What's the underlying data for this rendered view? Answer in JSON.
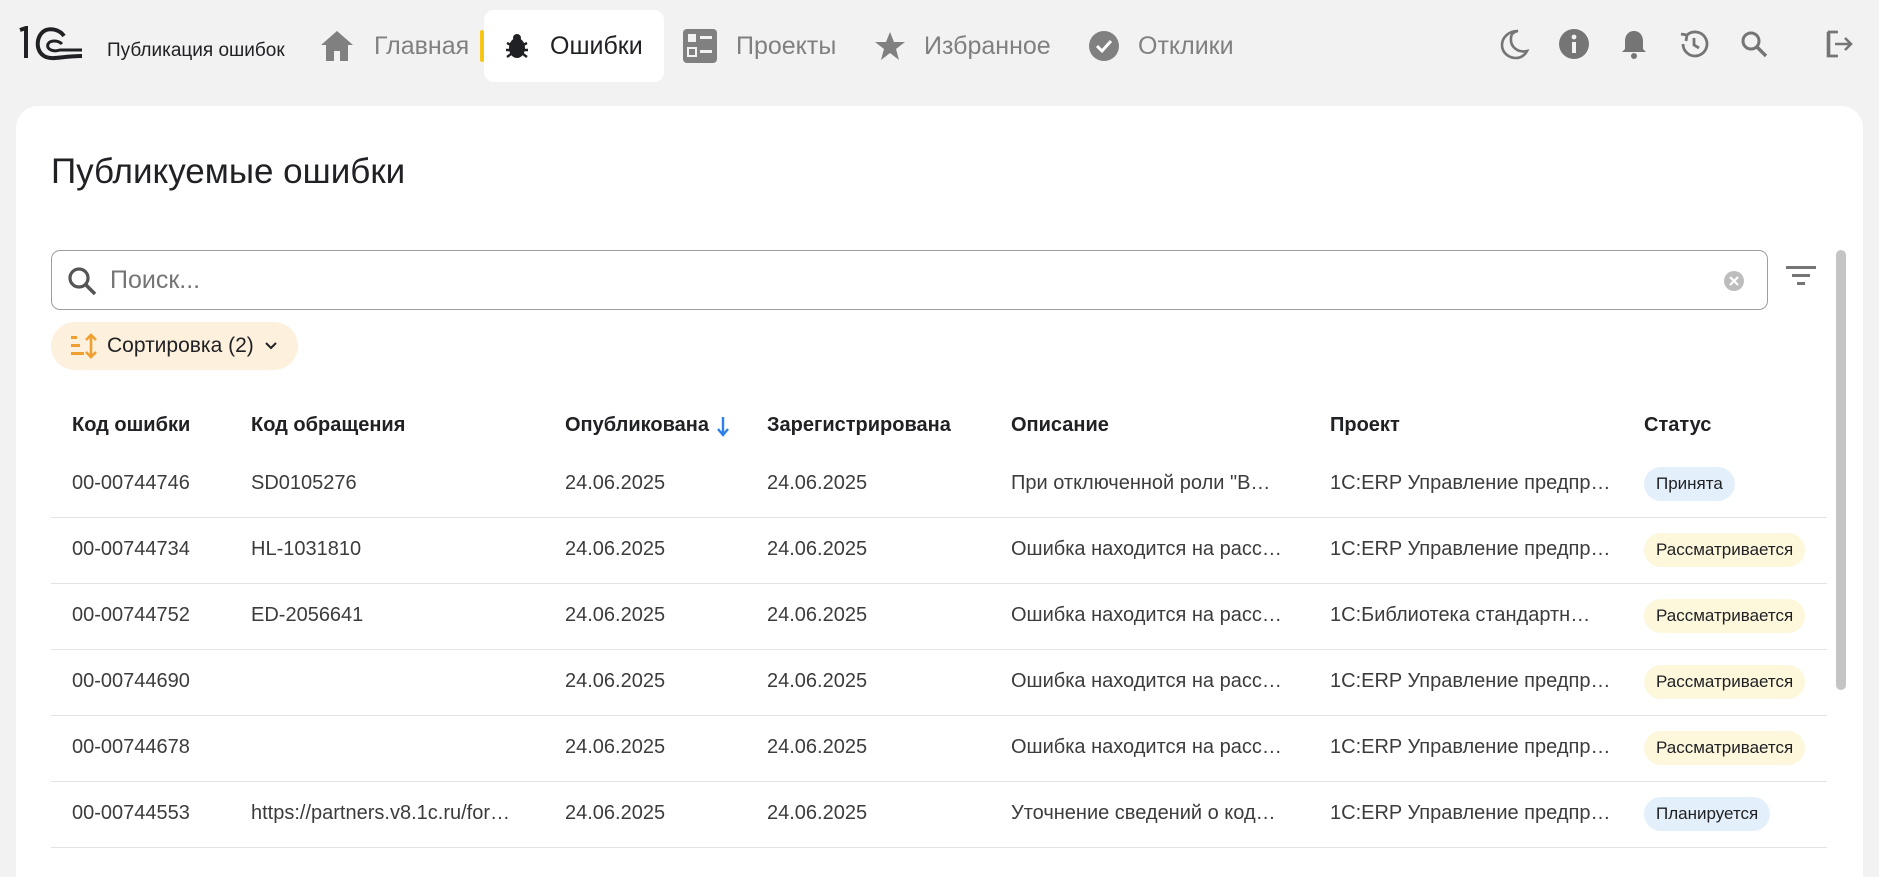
{
  "app": {
    "title": "Публикация ошибок",
    "logo": "1С"
  },
  "nav": {
    "items": [
      {
        "label": "Главная",
        "icon": "home-icon"
      },
      {
        "label": "Ошибки",
        "icon": "bug-icon",
        "active": true
      },
      {
        "label": "Проекты",
        "icon": "projects-icon"
      },
      {
        "label": "Избранное",
        "icon": "star-icon"
      },
      {
        "label": "Отклики",
        "icon": "check-circle-icon"
      }
    ],
    "right_icons": [
      "moon-icon",
      "info-icon",
      "bell-icon",
      "history-icon",
      "search-icon",
      "logout-icon"
    ]
  },
  "page": {
    "title": "Публикуемые ошибки"
  },
  "search": {
    "placeholder": "Поиск...",
    "value": ""
  },
  "sort": {
    "label": "Сортировка (2)"
  },
  "table": {
    "columns": [
      "Код ошибки",
      "Код обращения",
      "Опубликована",
      "Зарегистрирована",
      "Описание",
      "Проект",
      "Статус"
    ],
    "sorted_column": "Опубликована",
    "rows": [
      {
        "code": "00-00744746",
        "request": "SD0105276",
        "published": "24.06.2025",
        "registered": "24.06.2025",
        "description": "При отключенной роли \"В…",
        "project": "1С:ERP Управление предпр…",
        "status": "Принята",
        "status_kind": "accepted"
      },
      {
        "code": "00-00744734",
        "request": "HL-1031810",
        "published": "24.06.2025",
        "registered": "24.06.2025",
        "description": "Ошибка находится на расс…",
        "project": "1С:ERP Управление предпр…",
        "status": "Рассматривается",
        "status_kind": "review"
      },
      {
        "code": "00-00744752",
        "request": "ED-2056641",
        "published": "24.06.2025",
        "registered": "24.06.2025",
        "description": "Ошибка находится на расс…",
        "project": "1С:Библиотека стандартн…",
        "status": "Рассматривается",
        "status_kind": "review"
      },
      {
        "code": "00-00744690",
        "request": "",
        "published": "24.06.2025",
        "registered": "24.06.2025",
        "description": "Ошибка находится на расс…",
        "project": "1С:ERP Управление предпр…",
        "status": "Рассматривается",
        "status_kind": "review"
      },
      {
        "code": "00-00744678",
        "request": "",
        "published": "24.06.2025",
        "registered": "24.06.2025",
        "description": "Ошибка находится на расс…",
        "project": "1С:ERP Управление предпр…",
        "status": "Рассматривается",
        "status_kind": "review"
      },
      {
        "code": "00-00744553",
        "request": "https://partners.v8.1c.ru/for…",
        "published": "24.06.2025",
        "registered": "24.06.2025",
        "description": "Уточнение сведений о код…",
        "project": "1С:ERP Управление предпр…",
        "status": "Планируется",
        "status_kind": "planned"
      }
    ]
  },
  "colors": {
    "accent_yellow": "#f5c518",
    "sort_chip_bg": "#fdf0dd",
    "sort_icon": "#f0a030",
    "badge_blue": "#e3effa",
    "badge_yellow": "#fdf7dc",
    "sort_arrow": "#2f80ed"
  }
}
